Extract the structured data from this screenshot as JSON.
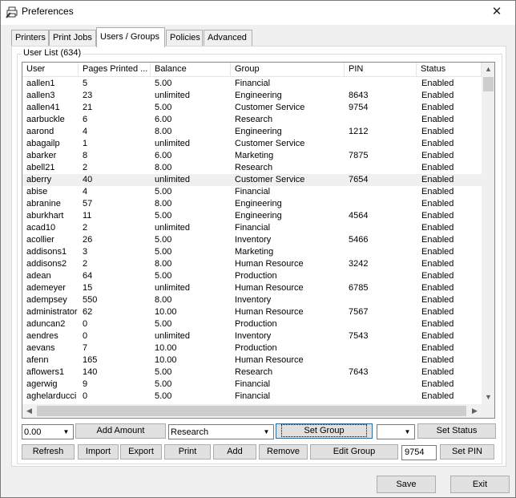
{
  "window": {
    "title": "Preferences",
    "close_glyph": "✕"
  },
  "tabs": [
    {
      "label": "Printers",
      "active": false
    },
    {
      "label": "Print Jobs",
      "active": false
    },
    {
      "label": "Users / Groups",
      "active": true
    },
    {
      "label": "Policies",
      "active": false
    },
    {
      "label": "Advanced",
      "active": false
    }
  ],
  "user_list": {
    "label": "User List (634)",
    "columns": [
      "User",
      "Pages Printed ...",
      "Balance",
      "Group",
      "PIN",
      "Status"
    ],
    "selected_index": 8,
    "rows": [
      [
        "aallen1",
        "5",
        "5.00",
        "Financial",
        "",
        "Enabled"
      ],
      [
        "aallen3",
        "23",
        "unlimited",
        "Engineering",
        "8643",
        "Enabled"
      ],
      [
        "aallen41",
        "21",
        "5.00",
        "Customer Service",
        "9754",
        "Enabled"
      ],
      [
        "aarbuckle",
        "6",
        "6.00",
        "Research",
        "",
        "Enabled"
      ],
      [
        "aarond",
        "4",
        "8.00",
        "Engineering",
        "1212",
        "Enabled"
      ],
      [
        "abagailp",
        "1",
        "unlimited",
        "Customer Service",
        "",
        "Enabled"
      ],
      [
        "abarker",
        "8",
        "6.00",
        "Marketing",
        "7875",
        "Enabled"
      ],
      [
        "abell21",
        "2",
        "8.00",
        "Research",
        "",
        "Enabled"
      ],
      [
        "aberry",
        "40",
        "unlimited",
        "Customer Service",
        "7654",
        "Enabled"
      ],
      [
        "abise",
        "4",
        "5.00",
        "Financial",
        "",
        "Enabled"
      ],
      [
        "abranine",
        "57",
        "8.00",
        "Engineering",
        "",
        "Enabled"
      ],
      [
        "aburkhart",
        "11",
        "5.00",
        "Engineering",
        "4564",
        "Enabled"
      ],
      [
        "acad10",
        "2",
        "unlimited",
        "Financial",
        "",
        "Enabled"
      ],
      [
        "acollier",
        "26",
        "5.00",
        "Inventory",
        "5466",
        "Enabled"
      ],
      [
        "addisons1",
        "3",
        "5.00",
        "Marketing",
        "",
        "Enabled"
      ],
      [
        "addisons2",
        "2",
        "8.00",
        "Human Resource",
        "3242",
        "Enabled"
      ],
      [
        "adean",
        "64",
        "5.00",
        "Production",
        "",
        "Enabled"
      ],
      [
        "ademeyer",
        "15",
        "unlimited",
        "Human Resource",
        "6785",
        "Enabled"
      ],
      [
        "adempsey",
        "550",
        "8.00",
        "Inventory",
        "",
        "Enabled"
      ],
      [
        "administrator",
        "62",
        "10.00",
        "Human Resource",
        "7567",
        "Enabled"
      ],
      [
        "aduncan2",
        "0",
        "5.00",
        "Production",
        "",
        "Enabled"
      ],
      [
        "aendres",
        "0",
        "unlimited",
        "Inventory",
        "7543",
        "Enabled"
      ],
      [
        "aevans",
        "7",
        "10.00",
        "Production",
        "",
        "Enabled"
      ],
      [
        "afenn",
        "165",
        "10.00",
        "Human Resource",
        "",
        "Enabled"
      ],
      [
        "aflowers1",
        "140",
        "5.00",
        "Research",
        "7643",
        "Enabled"
      ],
      [
        "agerwig",
        "9",
        "5.00",
        "Financial",
        "",
        "Enabled"
      ],
      [
        "aghelarducci",
        "0",
        "5.00",
        "Financial",
        "",
        "Enabled"
      ]
    ]
  },
  "controls": {
    "amount_value": "0.00",
    "add_amount": "Add Amount",
    "group_value": "Research",
    "set_group": "Set Group",
    "status_value": "",
    "set_status": "Set Status",
    "refresh": "Refresh",
    "import": "Import",
    "export": "Export",
    "print": "Print",
    "add": "Add",
    "remove": "Remove",
    "edit_group": "Edit Group",
    "pin_value": "9754",
    "set_pin": "Set PIN"
  },
  "footer": {
    "save": "Save",
    "exit": "Exit"
  },
  "icons": {
    "dropdown": "▼",
    "scroll_up": "▲",
    "scroll_down": "▼",
    "scroll_left": "◀",
    "scroll_right": "▶"
  }
}
